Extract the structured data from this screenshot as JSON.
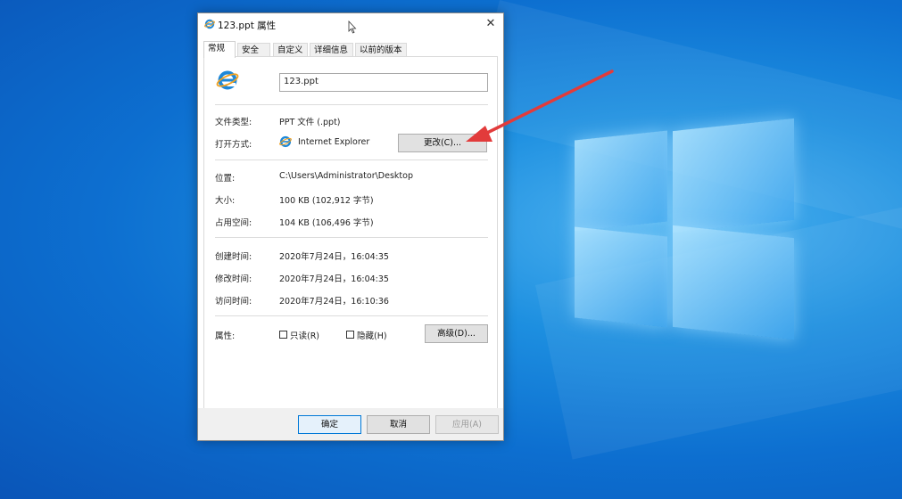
{
  "dialog": {
    "title": "123.ppt 属性",
    "close_glyph": "✕",
    "tabs": [
      "常规",
      "安全",
      "自定义",
      "详细信息",
      "以前的版本"
    ],
    "file_name": "123.ppt",
    "file_type_label": "文件类型:",
    "file_type_value": "PPT 文件 (.ppt)",
    "open_with_label": "打开方式:",
    "open_with_value": "Internet Explorer",
    "change_button": "更改(C)...",
    "location_label": "位置:",
    "location_value": "C:\\Users\\Administrator\\Desktop",
    "size_label": "大小:",
    "size_value": "100 KB (102,912 字节)",
    "size_on_disk_label": "占用空间:",
    "size_on_disk_value": "104 KB (106,496 字节)",
    "created_label": "创建时间:",
    "created_value": "2020年7月24日，16:04:35",
    "modified_label": "修改时间:",
    "modified_value": "2020年7月24日，16:04:35",
    "accessed_label": "访问时间:",
    "accessed_value": "2020年7月24日，16:10:36",
    "attributes_label": "属性:",
    "readonly_label": "只读(R)",
    "hidden_label": "隐藏(H)",
    "advanced_button": "高级(D)...",
    "ok_button": "确定",
    "cancel_button": "取消",
    "apply_button": "应用(A)"
  },
  "colors": {
    "ie_blue": "#1e88d8",
    "ie_orange": "#f2a11f",
    "arrow_red": "#e23b3b",
    "desktop_blue": "#0d6fd0"
  },
  "icons": [
    "internet-explorer-icon",
    "close-icon",
    "cursor-icon",
    "red-arrow-annotation"
  ]
}
